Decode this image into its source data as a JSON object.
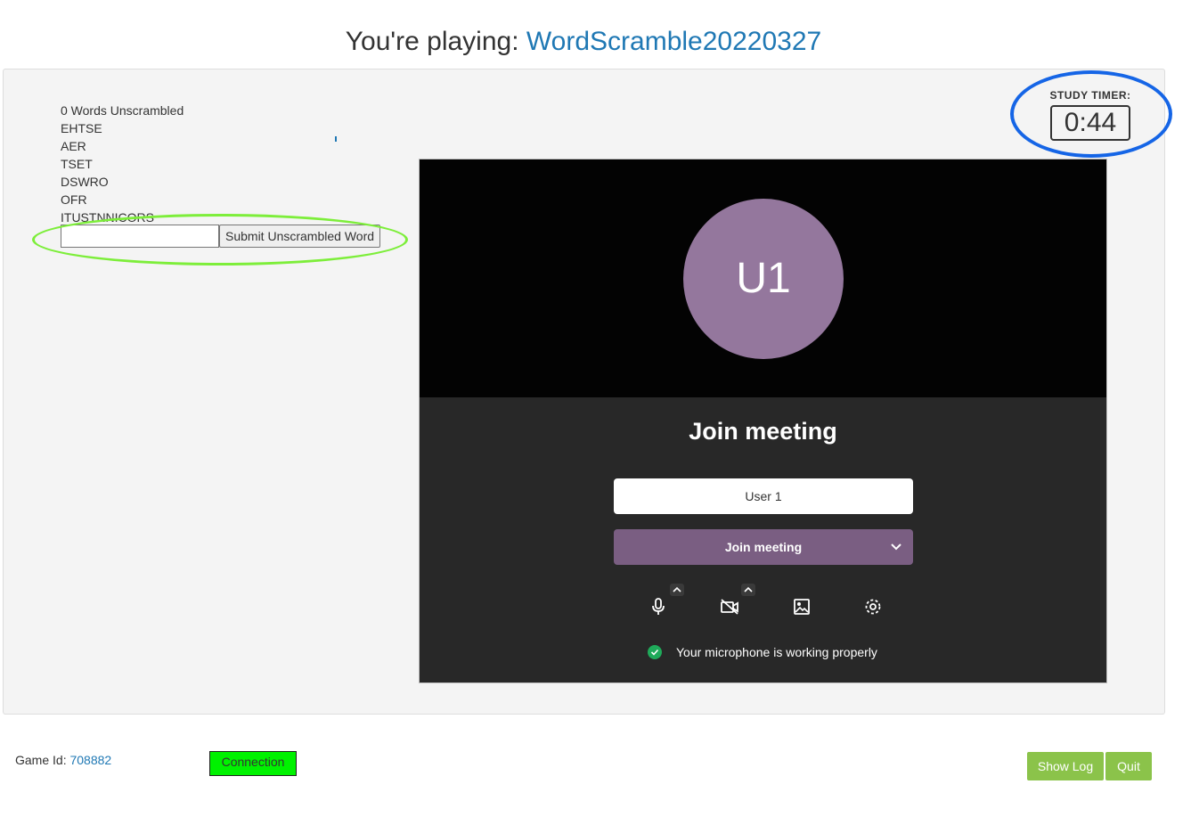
{
  "header": {
    "prefix": "You're playing: ",
    "game_name": "WordScramble20220327"
  },
  "game": {
    "count_label": "0 Words Unscrambled",
    "words": [
      "EHTSE",
      "AER",
      "TSET",
      "DSWRO",
      "OFR",
      "ITUSTNNICORS"
    ],
    "answer_value": "",
    "submit_label": "Submit Unscrambled Word"
  },
  "timer": {
    "label": "STUDY TIMER:",
    "value": "0:44"
  },
  "meeting": {
    "avatar_initials": "U1",
    "title": "Join meeting",
    "name_value": "User 1",
    "join_label": "Join meeting",
    "status": "Your microphone is working properly"
  },
  "footer": {
    "game_id_label": "Game Id: ",
    "game_id": "708882",
    "connection_label": "Connection",
    "show_log_label": "Show Log",
    "quit_label": "Quit"
  },
  "colors": {
    "link": "#1f78b4",
    "avatar": "#94779d",
    "join_button": "#7a5e82",
    "connection": "#00f200",
    "action_button": "#8bc34a",
    "highlight_green": "#7dee3a",
    "highlight_blue": "#1565e6"
  }
}
